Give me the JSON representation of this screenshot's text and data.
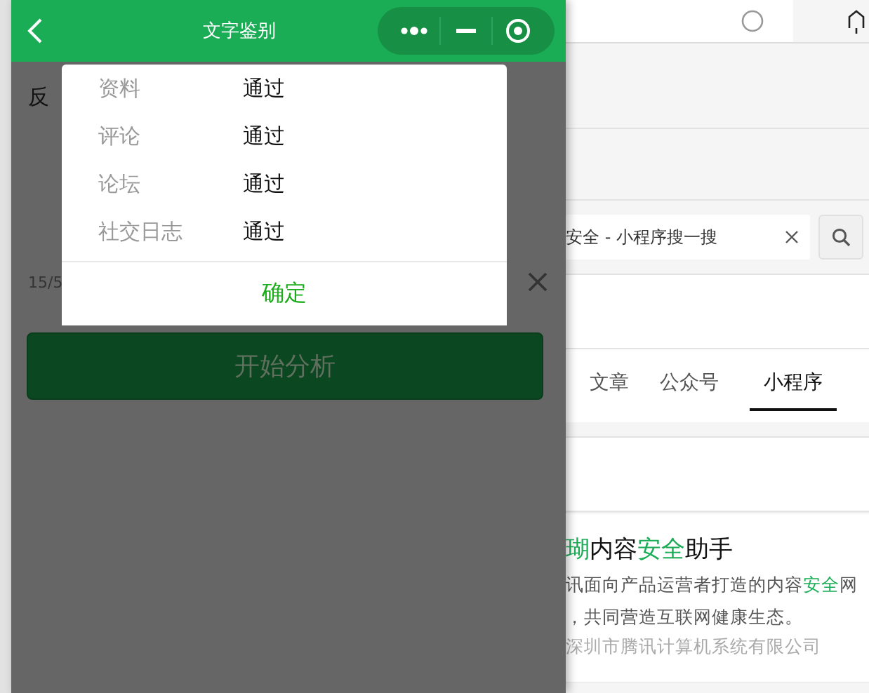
{
  "miniprogram": {
    "title": "文字鉴别",
    "content": {
      "label": "反",
      "counter": "15/5",
      "button": "开始分析"
    },
    "dialog": {
      "rows": [
        {
          "label": "资料",
          "value": "通过"
        },
        {
          "label": "评论",
          "value": "通过"
        },
        {
          "label": "论坛",
          "value": "通过"
        },
        {
          "label": "社交日志",
          "value": "通过"
        }
      ],
      "confirm": "确定"
    }
  },
  "browser": {
    "search": {
      "value": "安全 - 小程序搜一搜"
    },
    "tabs": [
      {
        "label": "文章",
        "selected": false
      },
      {
        "label": "公众号",
        "selected": false
      },
      {
        "label": "小程序",
        "selected": true
      }
    ],
    "result": {
      "title": [
        {
          "text": "瑚",
          "highlight": true
        },
        {
          "text": "内容",
          "highlight": false
        },
        {
          "text": "安全",
          "highlight": true
        },
        {
          "text": "助手",
          "highlight": false
        }
      ],
      "description": [
        [
          {
            "text": "讯面向产品运营者打造的内容",
            "highlight": false
          },
          {
            "text": "安全",
            "highlight": true
          },
          {
            "text": "网",
            "highlight": false
          }
        ],
        [
          {
            "text": "，共同营造互联网健康生态。",
            "highlight": false
          }
        ]
      ],
      "company": "深圳市腾讯计算机系统有限公司"
    }
  }
}
